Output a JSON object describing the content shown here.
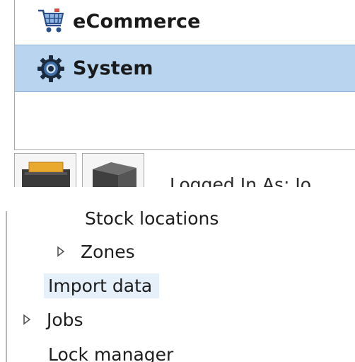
{
  "nav": {
    "items": [
      {
        "label": "eCommerce",
        "icon": "shopping-cart-icon"
      },
      {
        "label": "System",
        "icon": "gear-icon",
        "selected": true
      }
    ]
  },
  "status": {
    "logged_in_text": "Logged In As: Jo"
  },
  "toolbar": {
    "buttons": [
      {
        "icon": "printer-icon"
      },
      {
        "icon": "box-icon"
      }
    ]
  },
  "tree": {
    "items": [
      {
        "label": "Stock locations",
        "expandable": false
      },
      {
        "label": "Zones",
        "expandable": true
      },
      {
        "label": "Import data",
        "expandable": false,
        "hovered": true
      },
      {
        "label": "Jobs",
        "expandable": true
      },
      {
        "label": "Lock manager",
        "expandable": false
      }
    ]
  },
  "colors": {
    "selected_bg": "#b8d4ee",
    "hover_bg": "#e6f0fa",
    "border": "#a9a9a9"
  }
}
